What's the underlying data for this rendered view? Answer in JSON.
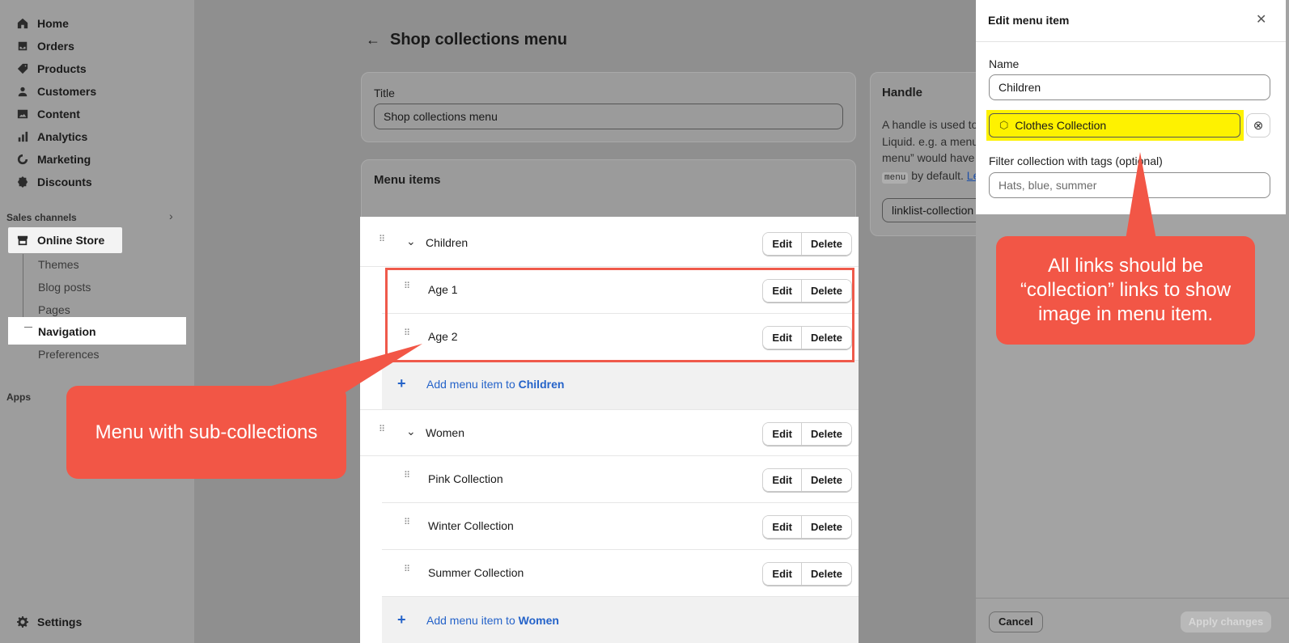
{
  "sidebar": {
    "items": [
      {
        "label": "Home",
        "icon": "home-icon"
      },
      {
        "label": "Orders",
        "icon": "inbox-icon"
      },
      {
        "label": "Products",
        "icon": "tag-icon"
      },
      {
        "label": "Customers",
        "icon": "person-icon"
      },
      {
        "label": "Content",
        "icon": "image-icon"
      },
      {
        "label": "Analytics",
        "icon": "bar-chart-icon"
      },
      {
        "label": "Marketing",
        "icon": "target-icon"
      },
      {
        "label": "Discounts",
        "icon": "discount-icon"
      }
    ],
    "sales_channels_label": "Sales channels",
    "online_store_label": "Online Store",
    "sub_items": [
      "Themes",
      "Blog posts",
      "Pages",
      "Navigation",
      "Preferences"
    ],
    "apps_label": "Apps",
    "settings_label": "Settings"
  },
  "page": {
    "title": "Shop collections menu",
    "title_field_label": "Title",
    "title_field_value": "Shop collections menu",
    "menu_items_heading": "Menu items",
    "handle_heading": "Handle",
    "handle_help_lines": [
      "A handle is used to",
      "Liquid. e.g. a menu",
      "menu” would have"
    ],
    "handle_code": "menu",
    "handle_default": "by default.",
    "handle_link": "Le",
    "handle_value": "linklist-collection"
  },
  "menu": {
    "edit_label": "Edit",
    "delete_label": "Delete",
    "add_prefix": "Add menu item to",
    "children": {
      "label": "Children",
      "items": [
        "Age 1",
        "Age 2"
      ],
      "add_target": "Children"
    },
    "women": {
      "label": "Women",
      "items": [
        "Pink Collection",
        "Winter Collection",
        "Summer Collection"
      ],
      "add_target": "Women"
    }
  },
  "panel": {
    "title": "Edit menu item",
    "name_label": "Name",
    "name_value": "Children",
    "link_value": "Clothes Collection",
    "filter_label": "Filter collection with tags (optional)",
    "filter_placeholder": "Hats, blue, summer",
    "cancel_label": "Cancel",
    "apply_label": "Apply changes"
  },
  "callouts": {
    "left": "Menu with sub-collections",
    "right": "All links should be “collection” links to show image in menu item."
  },
  "colors": {
    "callout": "#f25646",
    "highlight": "#fef200",
    "link": "#2563c9"
  }
}
